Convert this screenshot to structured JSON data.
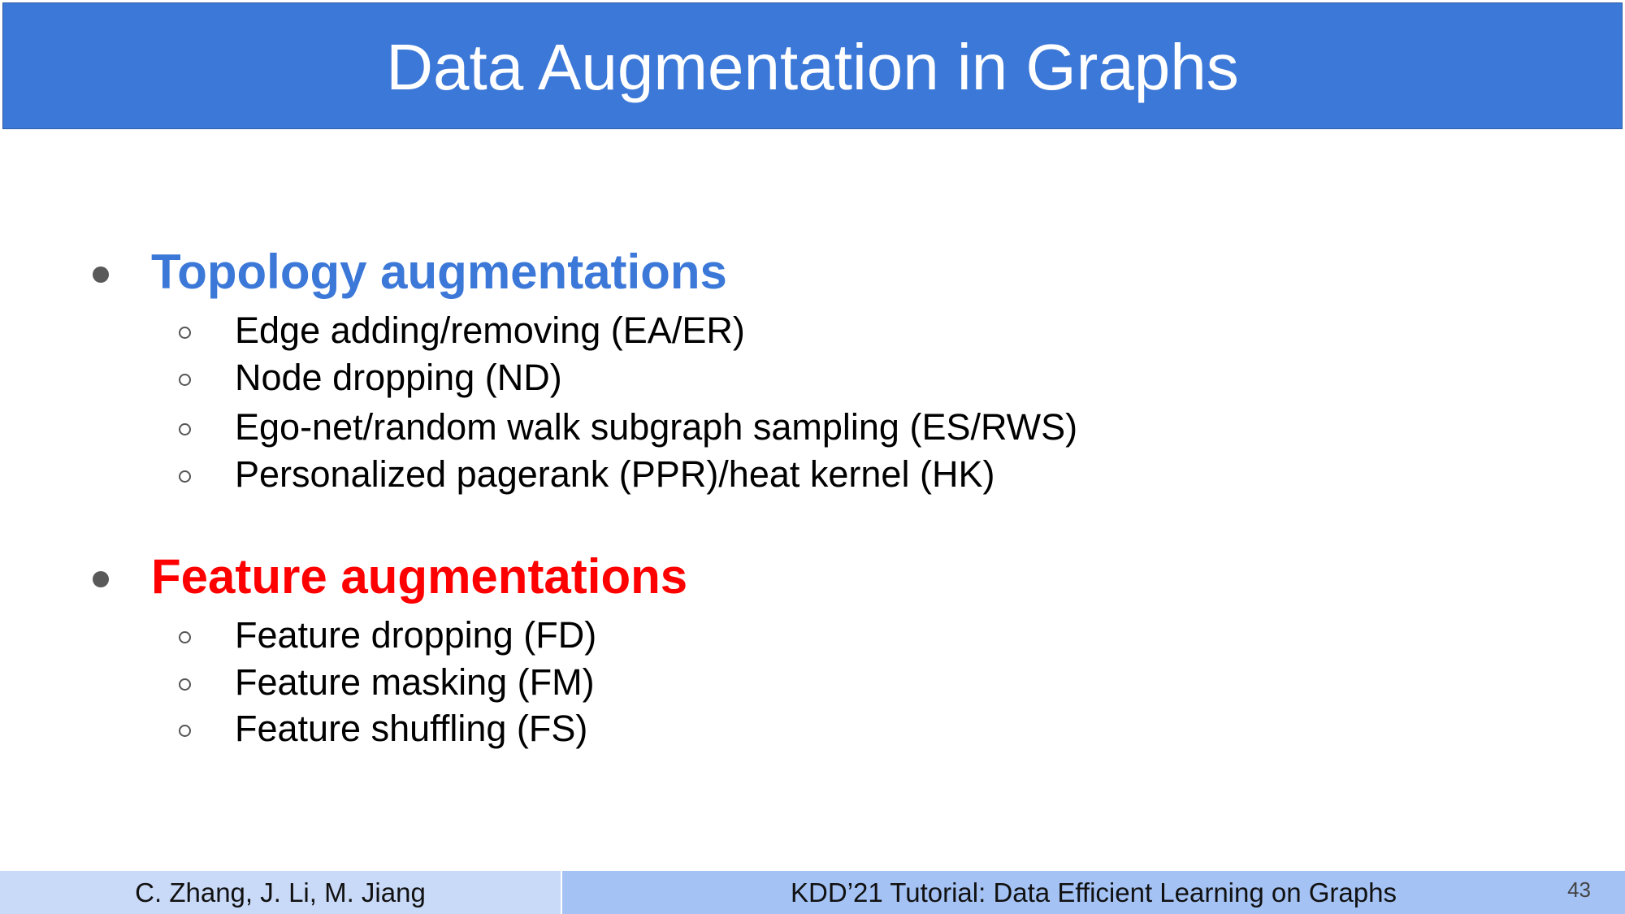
{
  "slide": {
    "title": "Data Augmentation in Graphs",
    "colors": {
      "title_bar": "#3c78d8",
      "topology_heading": "#3c78d8",
      "feature_heading": "#ff0000",
      "footer_left": "#c9daf8",
      "footer_right": "#a4c2f4"
    }
  },
  "sections": [
    {
      "heading": "Topology augmentations",
      "items": [
        "Edge adding/removing (EA/ER)",
        "Node dropping (ND)",
        "Ego-net/random walk subgraph sampling (ES/RWS)",
        "Personalized pagerank (PPR)/heat kernel (HK)"
      ]
    },
    {
      "heading": "Feature augmentations",
      "items": [
        "Feature dropping (FD)",
        "Feature masking (FM)",
        "Feature shuffling (FS)"
      ]
    }
  ],
  "footer": {
    "authors": "C. Zhang, J. Li, M. Jiang",
    "event": "KDD’21 Tutorial: Data Efficient Learning on Graphs",
    "page_number": "43"
  }
}
